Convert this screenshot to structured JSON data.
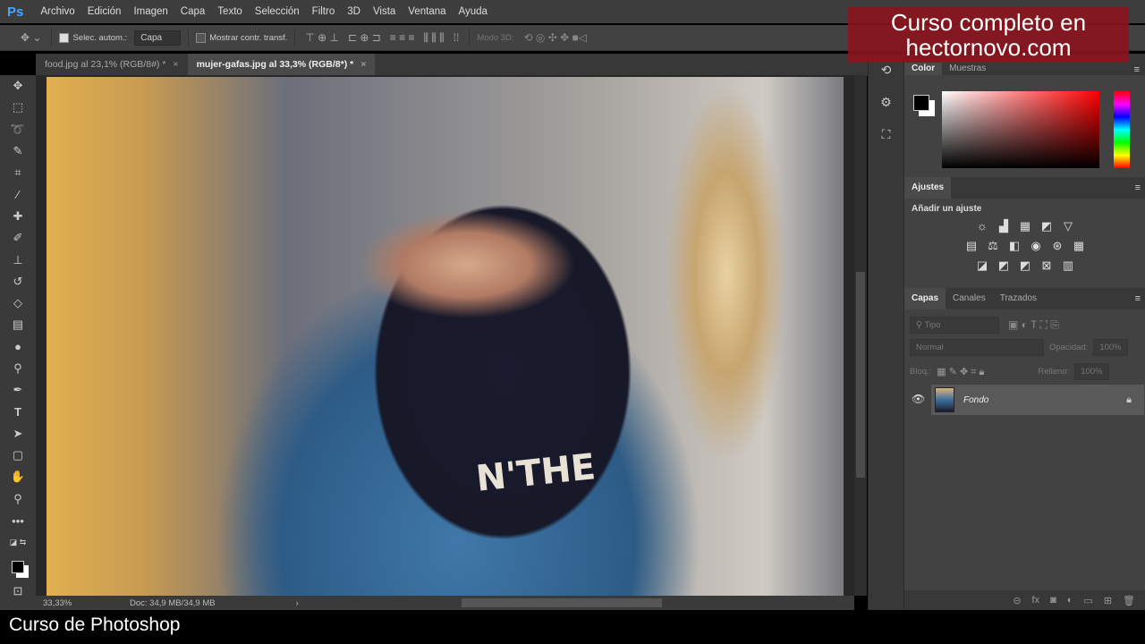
{
  "app": {
    "logo": "Ps"
  },
  "menu": [
    "Archivo",
    "Edición",
    "Imagen",
    "Capa",
    "Texto",
    "Selección",
    "Filtro",
    "3D",
    "Vista",
    "Ventana",
    "Ayuda"
  ],
  "options": {
    "auto_select_label": "Selec. autom.:",
    "auto_select_value": "Capa",
    "show_transform_label": "Mostrar contr. transf.",
    "mode3d_label": "Modo 3D:"
  },
  "tabs": [
    {
      "label": "food.jpg al 23,1% (RGB/8#) *"
    },
    {
      "label": "mujer-gafas.jpg al 33,3% (RGB/8*) *"
    }
  ],
  "canvas": {
    "shirt_text": "N'THE"
  },
  "status": {
    "zoom": "33,33%",
    "doc": "Doc: 34,9 MB/34,9 MB"
  },
  "panels": {
    "color": {
      "tabs": [
        "Color",
        "Muestras"
      ]
    },
    "adjust": {
      "tab": "Ajustes",
      "title": "Añadir un ajuste"
    },
    "layers": {
      "tabs": [
        "Capas",
        "Canales",
        "Trazados"
      ],
      "filter_placeholder": "Tipo",
      "blend": "Normal",
      "opacity_label": "Opacidad:",
      "opacity": "100%",
      "lock_label": "Bloq.:",
      "fill_label": "Relleno:",
      "fill": "100%",
      "layer_name": "Fondo"
    }
  },
  "overlay": {
    "promo_line1": "Curso completo en",
    "promo_line2": "hectornovo.com",
    "caption": "Curso de Photoshop"
  }
}
